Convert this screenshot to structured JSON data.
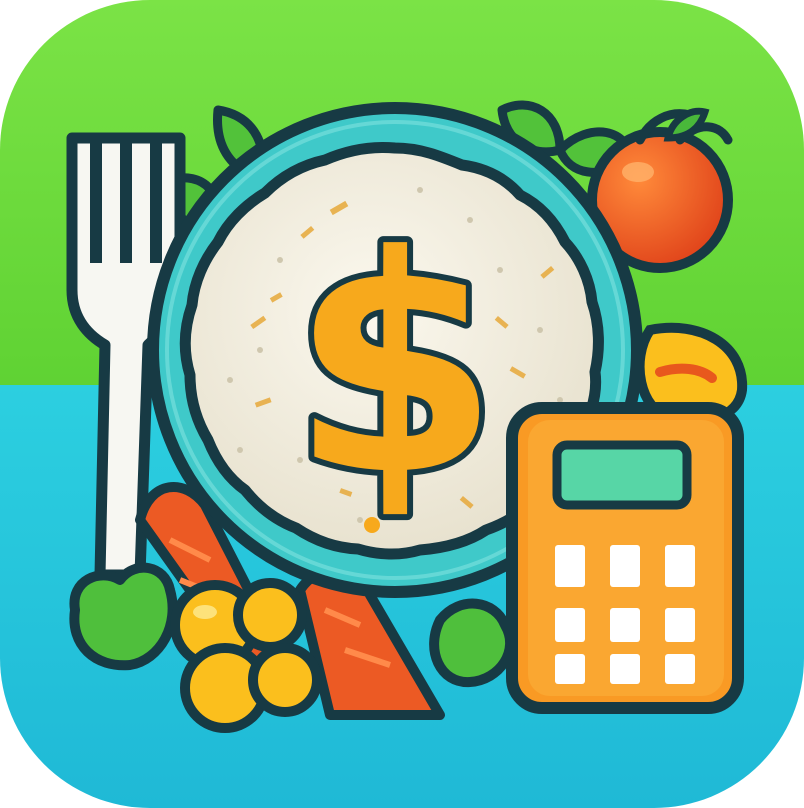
{
  "app_icon": {
    "icon": "meal-budget-app-icon",
    "currency_symbol": "$",
    "colors": {
      "top_green": "#6fdc3c",
      "bottom_cyan": "#22c6d8",
      "outline": "#173a44",
      "rice_white": "#f3efe2",
      "plate_teal": "#3fc9c9",
      "dollar_orange": "#f7a91c",
      "calculator_orange": "#f99a24",
      "calculator_screen": "#57d6a6",
      "tomato_red": "#ec4a1e",
      "carrot_orange": "#ec5a24",
      "leaf_green": "#49b83a",
      "fork_white": "#f7f7f2"
    },
    "calculator_keys": {
      "rows": 3,
      "columns": 3
    }
  }
}
